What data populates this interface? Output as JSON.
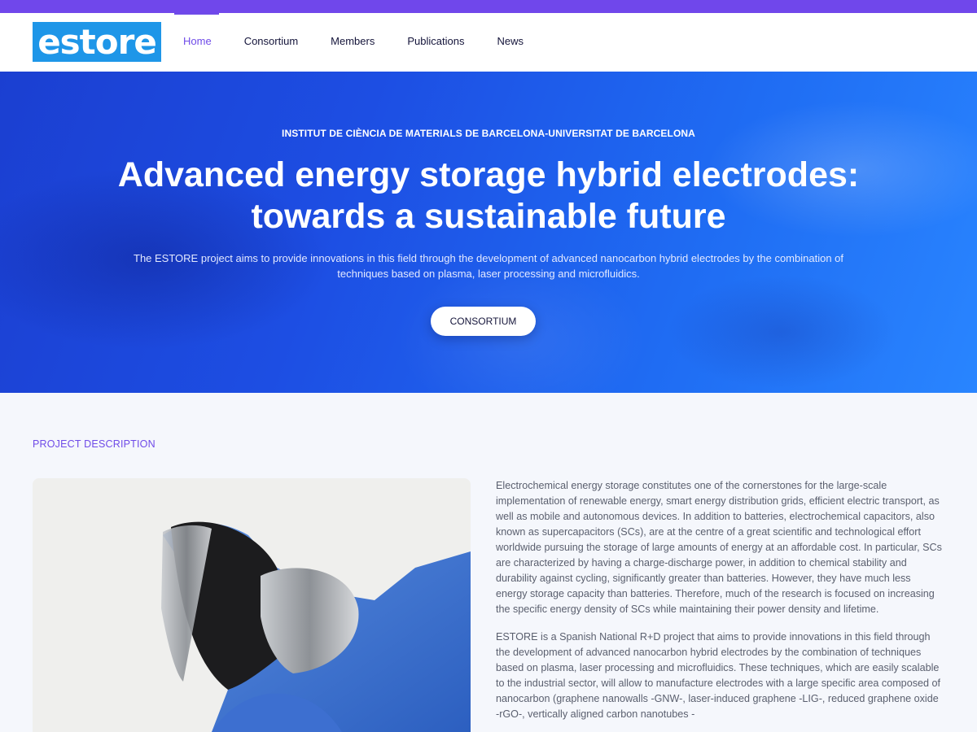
{
  "logo": {
    "text": "estore"
  },
  "nav": {
    "items": [
      "Home",
      "Consortium",
      "Members",
      "Publications",
      "News"
    ],
    "active": "Home"
  },
  "hero": {
    "kicker": "INSTITUT DE CIÈNCIA DE MATERIALS DE BARCELONA-UNIVERSITAT DE BARCELONA",
    "title": "Advanced energy storage hybrid electrodes: towards a sustainable future",
    "subtitle": "The ESTORE project aims to provide innovations in this field through the development of advanced nanocarbon hybrid electrodes by the combination of techniques based on plasma, laser processing and microfluidics.",
    "button": "CONSORTIUM"
  },
  "project": {
    "label": "PROJECT DESCRIPTION",
    "paragraphs": [
      "Electrochemical energy storage constitutes one of the cornerstones for the large-scale implementation of renewable energy, smart energy distribution grids, efficient electric transport, as well as mobile and autonomous devices. In addition to batteries, electrochemical capacitors, also known as supercapacitors (SCs), are at the centre of a great scientific and technological effort worldwide pursuing the storage of large amounts of energy at an affordable cost. In particular, SCs are characterized by having a charge-discharge power, in addition to chemical stability and durability against cycling, significantly greater than batteries. However, they have much less energy storage capacity than batteries. Therefore, much of the research is focused on increasing the specific energy density of SCs while maintaining their power density and lifetime.",
      "ESTORE is a Spanish National R+D project that aims to provide innovations in this field through the development of advanced nanocarbon hybrid electrodes by the combination of techniques based on plasma, laser processing and microfluidics. These techniques, which are easily scalable to the industrial sector, will allow to manufacture electrodes with a large specific area composed of nanocarbon (graphene nanowalls -GNW-, laser-induced graphene -LIG-, reduced graphene oxide -rGO-, vertically aligned carbon nanotubes -"
    ]
  },
  "colors": {
    "accent": "#6f4be8",
    "topbar": "#7047eb",
    "logo_bg": "#1e96e8",
    "hero_start": "#1b3fd1",
    "hero_end": "#2985ff"
  }
}
